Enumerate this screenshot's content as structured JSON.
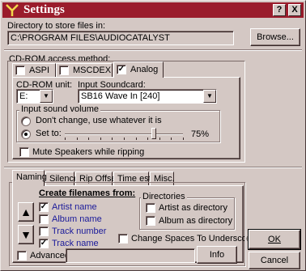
{
  "window": {
    "title": "Settings",
    "help_btn": "?",
    "close_btn": "X"
  },
  "directory": {
    "label": "Directory to store files in:",
    "value": "C:\\PROGRAM FILES\\AUDIOCATALYST",
    "browse": "Browse..."
  },
  "cdrom": {
    "label": "CD-ROM access method:",
    "tabs": [
      {
        "label": "ASPI",
        "checked": false
      },
      {
        "label": "MSCDEX",
        "checked": false
      },
      {
        "label": "Analog",
        "checked": true
      }
    ],
    "unit_label": "CD-ROM unit:",
    "unit_value": "E:",
    "soundcard_label": "Input Soundcard:",
    "soundcard_value": "SB16 Wave In [240]",
    "volume": {
      "label": "Input sound volume",
      "option1": "Don't change, use whatever it is",
      "option2": "Set to:",
      "selected": 2,
      "percent": "75%",
      "level": 0.75
    },
    "mute_label": "Mute Speakers while ripping"
  },
  "tabs": [
    {
      "label": "Naming"
    },
    {
      "label": "Silence"
    },
    {
      "label": "Rip Offset"
    },
    {
      "label": "Time est."
    },
    {
      "label": "Misc."
    }
  ],
  "naming": {
    "create_label": "Create filenames from:",
    "items": [
      {
        "label": "Artist name",
        "checked": true
      },
      {
        "label": "Album name",
        "checked": false
      },
      {
        "label": "Track number",
        "checked": false
      },
      {
        "label": "Track name",
        "checked": true
      }
    ],
    "directories_label": "Directories",
    "dir_artist": "Artist as directory",
    "dir_album": "Album as directory",
    "spaces_label": "Change Spaces To Underscores",
    "advanced_label": "Advanced",
    "info_btn": "Info"
  },
  "buttons": {
    "ok": "OK",
    "cancel": "Cancel"
  }
}
